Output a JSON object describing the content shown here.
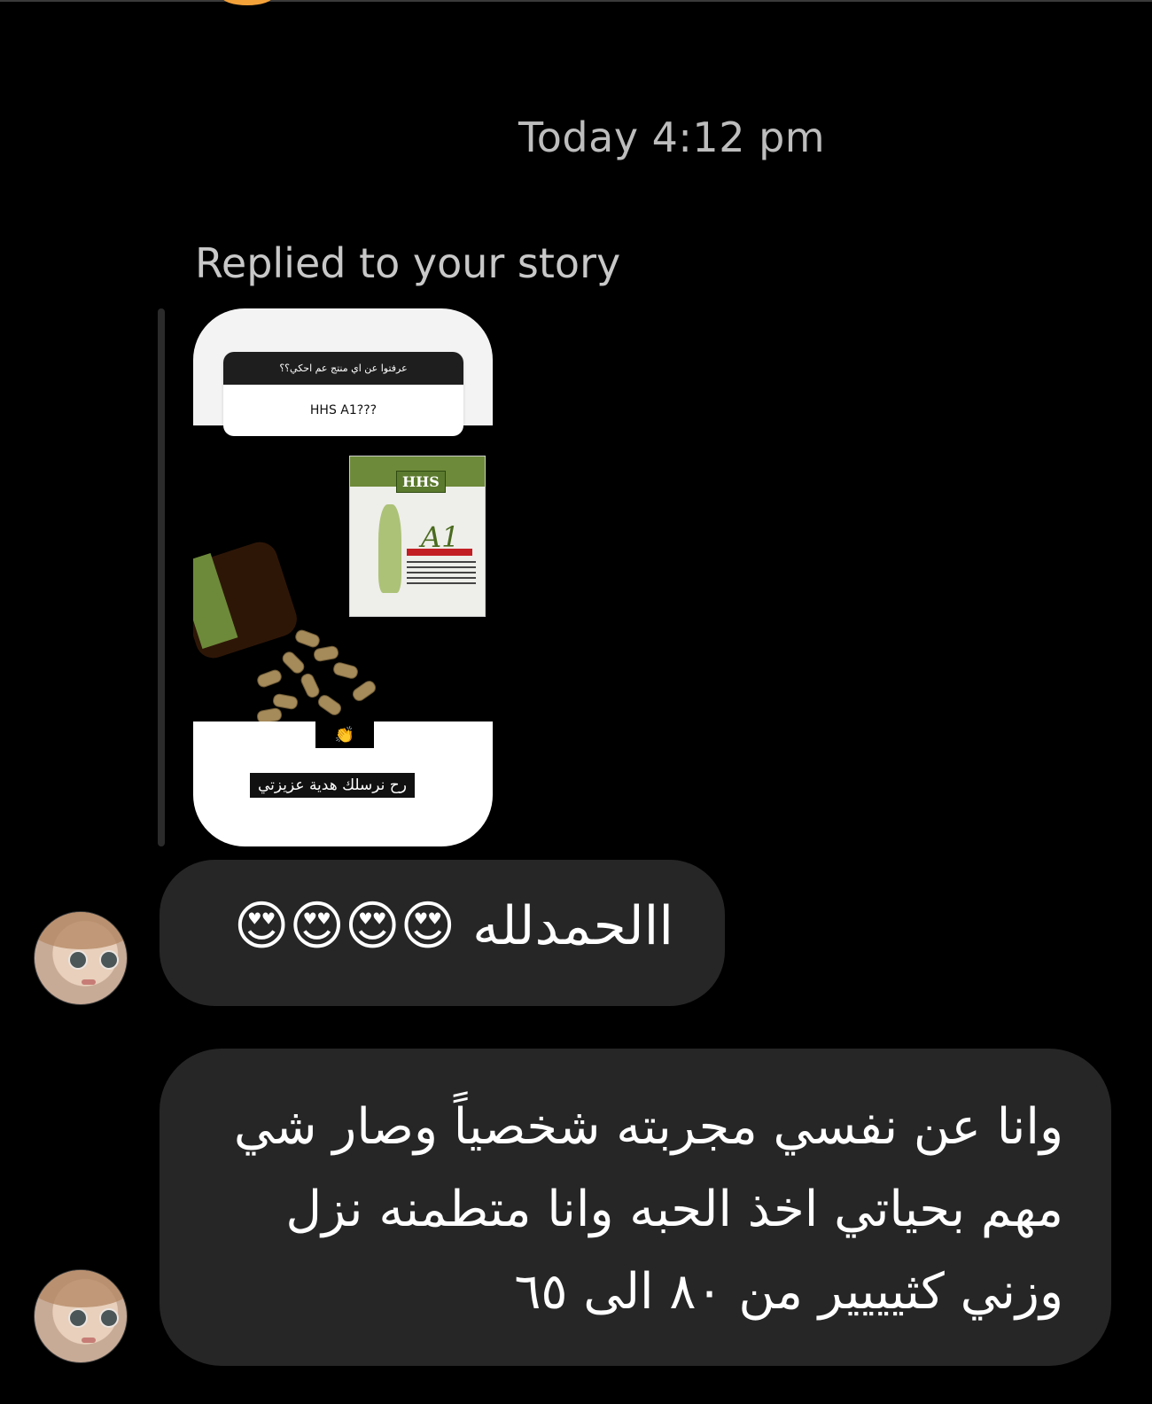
{
  "chat": {
    "timestamp": "Today 4:12 pm",
    "reply_label": "Replied to your story",
    "story": {
      "question": "عرفتوا عن اي منتج عم احكي؟؟",
      "answer": "HHS A1???",
      "product_brand": "HHS",
      "product_name": "A1",
      "emoji": "👏",
      "caption": "رح نرسلك هدية عزيزتي"
    },
    "messages": [
      {
        "text": "االحمدلله 😍😍😍😍"
      },
      {
        "text": "وانا عن نفسي مجربته شخصياً وصار شي مهم بحياتي اخذ الحبه وانا متطمنه نزل وزني كثيييير من ٨٠ الى ٦٥"
      }
    ]
  },
  "colors": {
    "background": "#000000",
    "bubble": "#262626",
    "muted_text": "#bdbdbd"
  }
}
